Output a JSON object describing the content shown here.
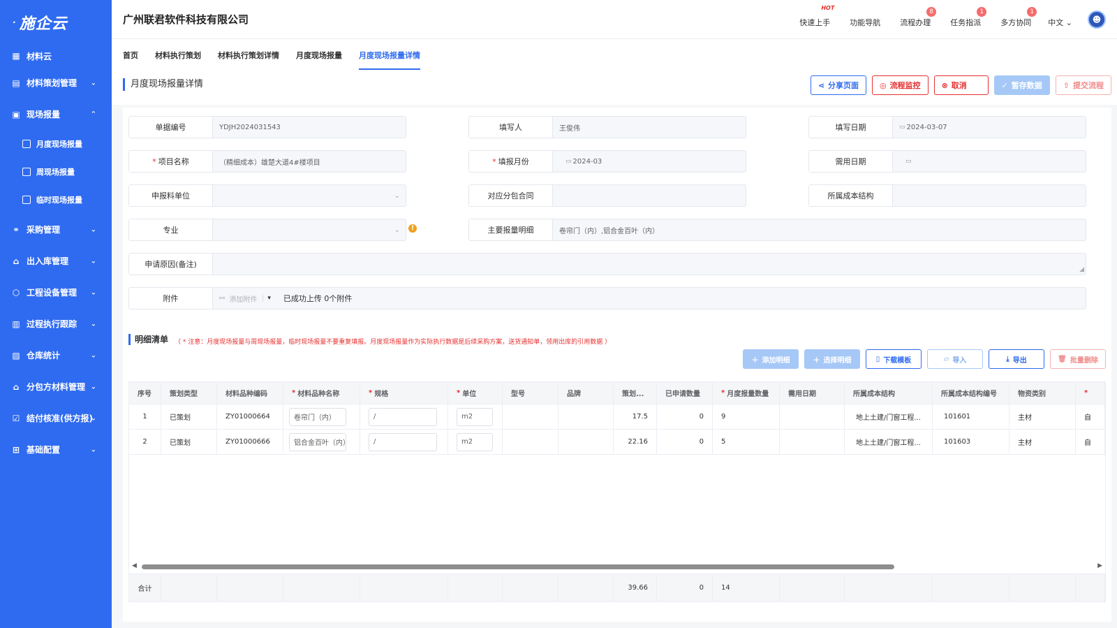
{
  "brand": {
    "logo_text": "施企云"
  },
  "sidebar": {
    "items": [
      {
        "label": "材料云",
        "icon": "grid-icon",
        "chevron": ""
      },
      {
        "label": "材料策划管理",
        "icon": "ledger-icon",
        "chevron": "⌄"
      },
      {
        "label": "现场报量",
        "icon": "report-icon",
        "chevron": "⌃"
      },
      {
        "label": "采购管理",
        "icon": "org-icon",
        "chevron": "⌄"
      },
      {
        "label": "出入库管理",
        "icon": "warehouse-icon",
        "chevron": "⌄"
      },
      {
        "label": "工程设备管理",
        "icon": "cube-icon",
        "chevron": "⌄"
      },
      {
        "label": "过程执行跟踪",
        "icon": "track-icon",
        "chevron": "⌄"
      },
      {
        "label": "仓库统计",
        "icon": "stats-icon",
        "chevron": "⌄"
      },
      {
        "label": "分包方材料管理",
        "icon": "building-icon",
        "chevron": "⌄"
      },
      {
        "label": "结付核准(供方报)",
        "icon": "check-doc-icon",
        "chevron": "⌄"
      },
      {
        "label": "基础配置",
        "icon": "apps-icon",
        "chevron": "⌄"
      }
    ],
    "sub_items": [
      {
        "label": "月度现场报量"
      },
      {
        "label": "周现场报量"
      },
      {
        "label": "临时现场报量"
      }
    ]
  },
  "header": {
    "company": "广州联君软件科技有限公司",
    "links": [
      {
        "label": "快速上手",
        "badge": "HOT"
      },
      {
        "label": "功能导航",
        "badge": ""
      },
      {
        "label": "流程办理",
        "badge": "8"
      },
      {
        "label": "任务指派",
        "badge": "1"
      },
      {
        "label": "多方协同",
        "badge": "1"
      }
    ],
    "language": "中文"
  },
  "tabs": [
    "首页",
    "材料执行策划",
    "材料执行策划详情",
    "月度现场报量",
    "月度现场报量详情"
  ],
  "page": {
    "title": "月度现场报量详情",
    "buttons": {
      "share": "分享页面",
      "monitor": "流程监控",
      "cancel": "取消",
      "save": "暂存数据",
      "submit": "提交流程"
    }
  },
  "form": {
    "doc_no": {
      "label": "单据编号",
      "value": "YDJH2024031543"
    },
    "writer": {
      "label": "填写人",
      "value": "王俊伟"
    },
    "fill_date": {
      "label": "填写日期",
      "value": "2024-03-07"
    },
    "project": {
      "label": "项目名称",
      "value": "（精细成本）雄楚大道4#楼项目"
    },
    "report_month": {
      "label": "填报月份",
      "value": "2024-03"
    },
    "need_date": {
      "label": "需用日期",
      "value": ""
    },
    "apply_unit": {
      "label": "申报料单位",
      "value": ""
    },
    "sub_contract": {
      "label": "对应分包合同",
      "value": ""
    },
    "cost_structure": {
      "label": "所属成本结构",
      "value": ""
    },
    "major": {
      "label": "专业",
      "value": ""
    },
    "main_detail": {
      "label": "主要报量明细",
      "value": "卷帘门（内）,铝合金百叶（内）"
    },
    "reason": {
      "label": "申请原因(备注)",
      "value": ""
    },
    "attachment": {
      "label": "附件",
      "add_label": "添加附件",
      "status": "已成功上传 0个附件"
    }
  },
  "detail": {
    "title": "明细清单",
    "note": "（ * 注意：月度现场报量与周现场报量，临时现场报量不要重复填报。月度现场报量作为实际执行数据是后续采购方案，送货通知单，领用出库的引用数据 ）",
    "buttons": {
      "add": "添加明细",
      "select": "选择明细",
      "download": "下载模板",
      "import": "导入",
      "export": "导出",
      "batch_delete": "批量删除"
    },
    "columns": [
      "序号",
      "策划类型",
      "材料品种编码",
      "材料品种名称",
      "规格",
      "单位",
      "型号",
      "品牌",
      "策划...",
      "已申请数量",
      "月度报量数量",
      "需用日期",
      "所属成本结构",
      "所属成本结构编号",
      "物资类别",
      "*"
    ],
    "rows": [
      {
        "no": "1",
        "type": "已策划",
        "code": "ZY01000664",
        "name": "卷帘门（内）",
        "spec": "/",
        "unit": "m2",
        "model": "",
        "brand": "",
        "planned": "17.5",
        "applied": "0",
        "monthly": "9",
        "need_date": "",
        "cost": "地上土建/门窗工程...",
        "cost_no": "101601",
        "category": "主材",
        "extra": "自"
      },
      {
        "no": "2",
        "type": "已策划",
        "code": "ZY01000666",
        "name": "铝合金百叶（内）",
        "spec": "/",
        "unit": "m2",
        "model": "",
        "brand": "",
        "planned": "22.16",
        "applied": "0",
        "monthly": "5",
        "need_date": "",
        "cost": "地上土建/门窗工程...",
        "cost_no": "101603",
        "category": "主材",
        "extra": "自"
      }
    ],
    "total": {
      "label": "合计",
      "planned": "39.66",
      "applied": "0",
      "monthly": "14"
    }
  },
  "colors": {
    "primary": "#2f6bf0",
    "danger": "#e5302f",
    "warning": "#f0a020"
  }
}
